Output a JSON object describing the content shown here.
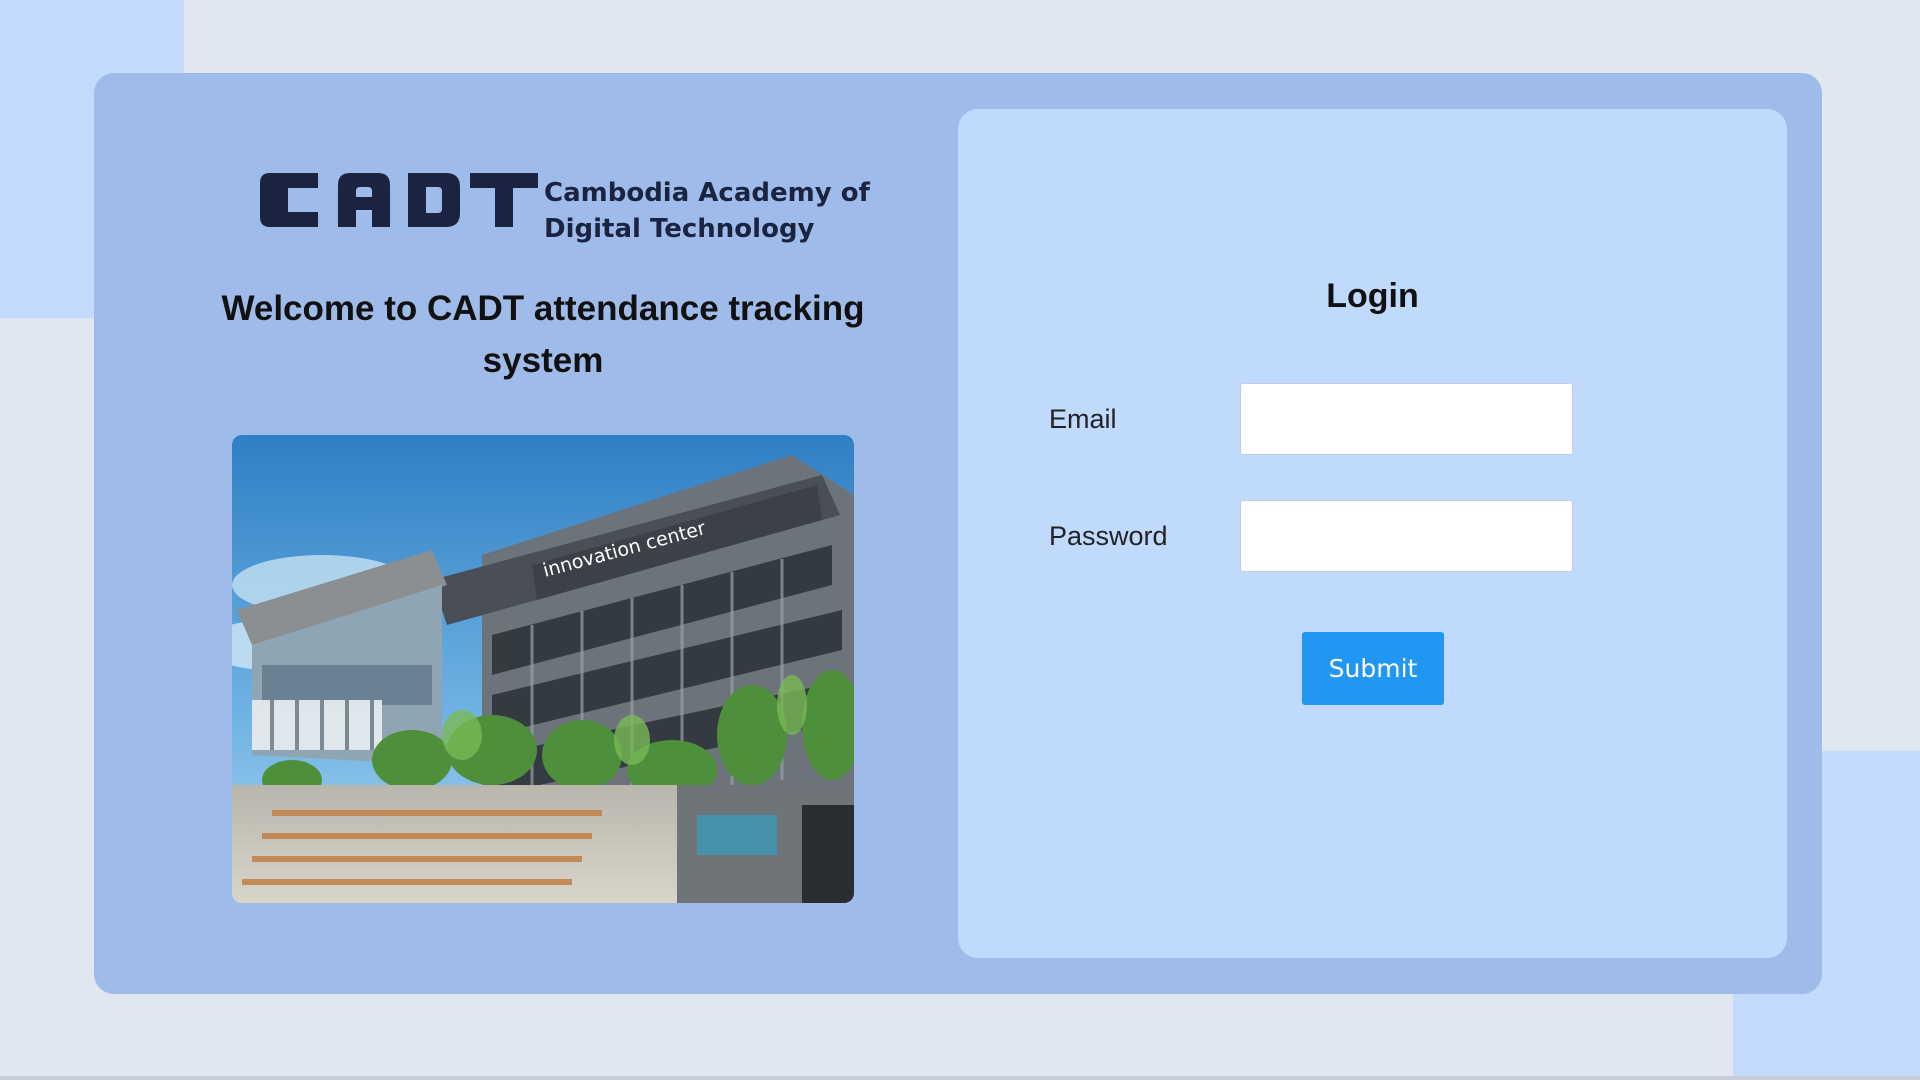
{
  "logo": {
    "mark": "CADT",
    "line1": "Cambodia Academy of",
    "line2": "Digital Technology",
    "color": "#1a2440"
  },
  "welcome": {
    "line1": "Welcome to CADT attendance tracking",
    "line2": "system"
  },
  "photo": {
    "sign_text": "innovation center"
  },
  "login": {
    "title": "Login",
    "email_label": "Email",
    "email_value": "",
    "password_label": "Password",
    "password_value": "",
    "submit_label": "Submit"
  },
  "colors": {
    "page_bg": "#e1e7f0",
    "accent_blocks": "#c2dbfc",
    "outer_card": "#9fbbe9",
    "login_card": "#bfdafc",
    "submit_button": "#2196f3"
  }
}
